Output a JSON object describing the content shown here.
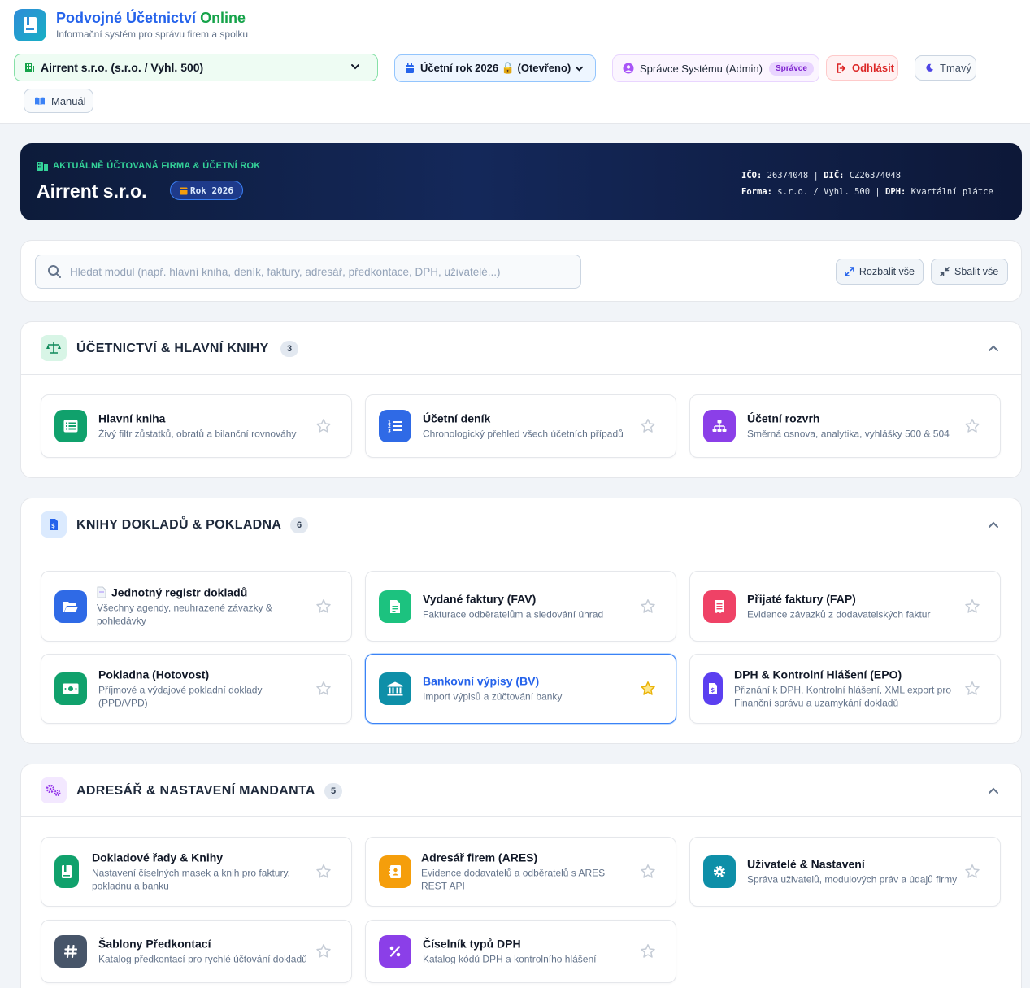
{
  "app": {
    "title_part1": "Podvojné Účetnictví",
    "title_part2": "Online",
    "subtitle": "Informační systém pro správu firem a spolku"
  },
  "toolbar": {
    "company": "Airrent s.r.o. (s.r.o. / Vyhl. 500)",
    "year": "Účetní rok 2026 🔓 (Otevřeno)",
    "user": "Správce Systému (Admin)",
    "role": "Správce",
    "logout": "Odhlásit",
    "theme": "Tmavý",
    "manual": "Manuál"
  },
  "banner": {
    "label": "AKTUÁLNĚ ÚČTOVANÁ FIRMA & ÚČETNÍ ROK",
    "company": "Airrent s.r.o.",
    "year_badge": "Rok 2026",
    "ico_label": "IČO:",
    "ico": "26374048",
    "dic_label": "DIČ:",
    "dic": "CZ26374048",
    "forma_label": "Forma:",
    "forma": "s.r.o. / Vyhl. 500",
    "dph_label": "DPH:",
    "dph": "Kvartální plátce"
  },
  "search": {
    "placeholder": "Hledat modul (např. hlavní kniha, deník, faktury, adresář, předkontace, DPH, uživatelé...)",
    "expand_all": "Rozbalit vše",
    "collapse_all": "Sbalit vše"
  },
  "sections": [
    {
      "title": "ÚČETNICTVÍ & HLAVNÍ KNIHY",
      "count": "3",
      "icon": "scale-icon",
      "modules": [
        {
          "title": "Hlavní kniha",
          "desc": "Živý filtr zůstatků, obratů a bilanční rovnováhy",
          "icon": "table-list-icon",
          "color": "#10a16c"
        },
        {
          "title": "Účetní deník",
          "desc": "Chronologický přehled všech účetních případů",
          "icon": "numbered-list-icon",
          "color": "#2f6ae6"
        },
        {
          "title": "Účetní rozvrh",
          "desc": "Směrná osnova, analytika, vyhlášky 500 & 504",
          "icon": "sitemap-icon",
          "color": "#8b3fe8"
        }
      ]
    },
    {
      "title": "KNIHY DOKLADŮ & POKLADNA",
      "count": "6",
      "icon": "invoice-icon",
      "modules": [
        {
          "title": "Jednotný registr dokladů",
          "desc": "Všechny agendy, neuhrazené závazky & pohledávky",
          "icon": "folder-open-icon",
          "color": "#2f6ae6"
        },
        {
          "title": "Vydané faktury (FAV)",
          "desc": "Fakturace odběratelům a sledování úhrad",
          "icon": "invoice-out-icon",
          "color": "#1cc27f"
        },
        {
          "title": "Přijaté faktury (FAP)",
          "desc": "Evidence závazků z dodavatelských faktur",
          "icon": "receipt-icon",
          "color": "#ef4266"
        },
        {
          "title": "Pokladna (Hotovost)",
          "desc": "Příjmové a výdajové pokladní doklady (PPD/VPD)",
          "icon": "cash-icon",
          "color": "#10a16c"
        },
        {
          "title": "Bankovní výpisy (BV)",
          "desc": "Import výpisů a zúčtování banky",
          "icon": "bank-icon",
          "color": "#0e8fa8"
        },
        {
          "title": "DPH & Kontrolní Hlášení (EPO)",
          "desc": "Přiznání k DPH, Kontrolní hlášení, XML export pro Finanční správu a uzamykání dokladů",
          "icon": "tax-file-icon",
          "color": "#5b3ff0"
        }
      ]
    },
    {
      "title": "ADRESÁŘ & NASTAVENÍ MANDANTA",
      "count": "5",
      "icon": "cogs-icon",
      "modules": [
        {
          "title": "Dokladové řady & Knihy",
          "desc": "Nastavení číselných masek a knih pro faktury, pokladnu a banku",
          "icon": "book-icon",
          "color": "#10a16c"
        },
        {
          "title": "Adresář firem (ARES)",
          "desc": "Evidence dodavatelů a odběratelů s ARES REST API",
          "icon": "address-book-icon",
          "color": "#f59e0b"
        },
        {
          "title": "Uživatelé & Nastavení",
          "desc": "Správa uživatelů, modulových práv a údajů firmy",
          "icon": "gear-icon",
          "color": "#0e8fa8"
        },
        {
          "title": "Šablony Předkontací",
          "desc": "Katalog předkontací pro rychlé účtování dokladů",
          "icon": "hashtag-icon",
          "color": "#475569"
        },
        {
          "title": "Číselník typů DPH",
          "desc": "Katalog kódů DPH a kontrolního hlášení",
          "icon": "percent-icon",
          "color": "#8b3fe8"
        }
      ]
    }
  ]
}
